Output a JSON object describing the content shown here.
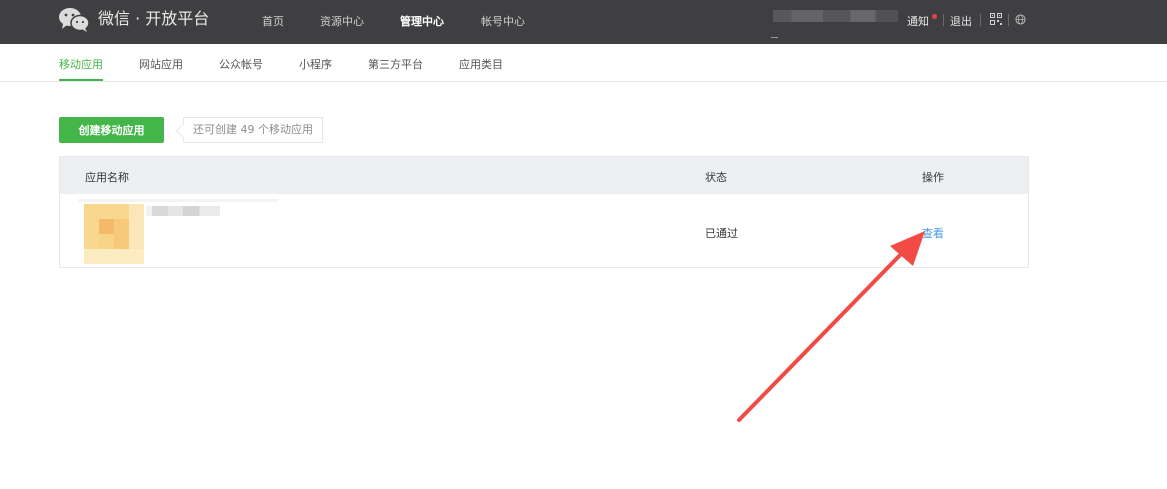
{
  "header": {
    "brand": "微信 · 开放平台",
    "nav": [
      {
        "label": "首页",
        "active": false
      },
      {
        "label": "资源中心",
        "active": false
      },
      {
        "label": "管理中心",
        "active": true
      },
      {
        "label": "帐号中心",
        "active": false
      }
    ],
    "notify_label": "通知",
    "logout_label": "退出",
    "icons": [
      "wechat-logo-icon",
      "qrcode-icon",
      "globe-icon"
    ]
  },
  "subnav": {
    "tabs": [
      {
        "label": "移动应用",
        "active": true
      },
      {
        "label": "网站应用",
        "active": false
      },
      {
        "label": "公众帐号",
        "active": false
      },
      {
        "label": "小程序",
        "active": false
      },
      {
        "label": "第三方平台",
        "active": false
      },
      {
        "label": "应用类目",
        "active": false
      }
    ]
  },
  "main": {
    "create_button": "创建移动应用",
    "remaining_tip": "还可创建 49 个移动应用",
    "table": {
      "headers": {
        "name": "应用名称",
        "status": "状态",
        "action": "操作"
      },
      "rows": [
        {
          "status": "已通过",
          "action": "查看"
        }
      ]
    }
  },
  "colors": {
    "topbar": "#3f3f41",
    "accent_green": "#44b549",
    "link_blue": "#459ae9",
    "notify_red": "#e64340",
    "annotation_arrow": "#f24b45"
  }
}
